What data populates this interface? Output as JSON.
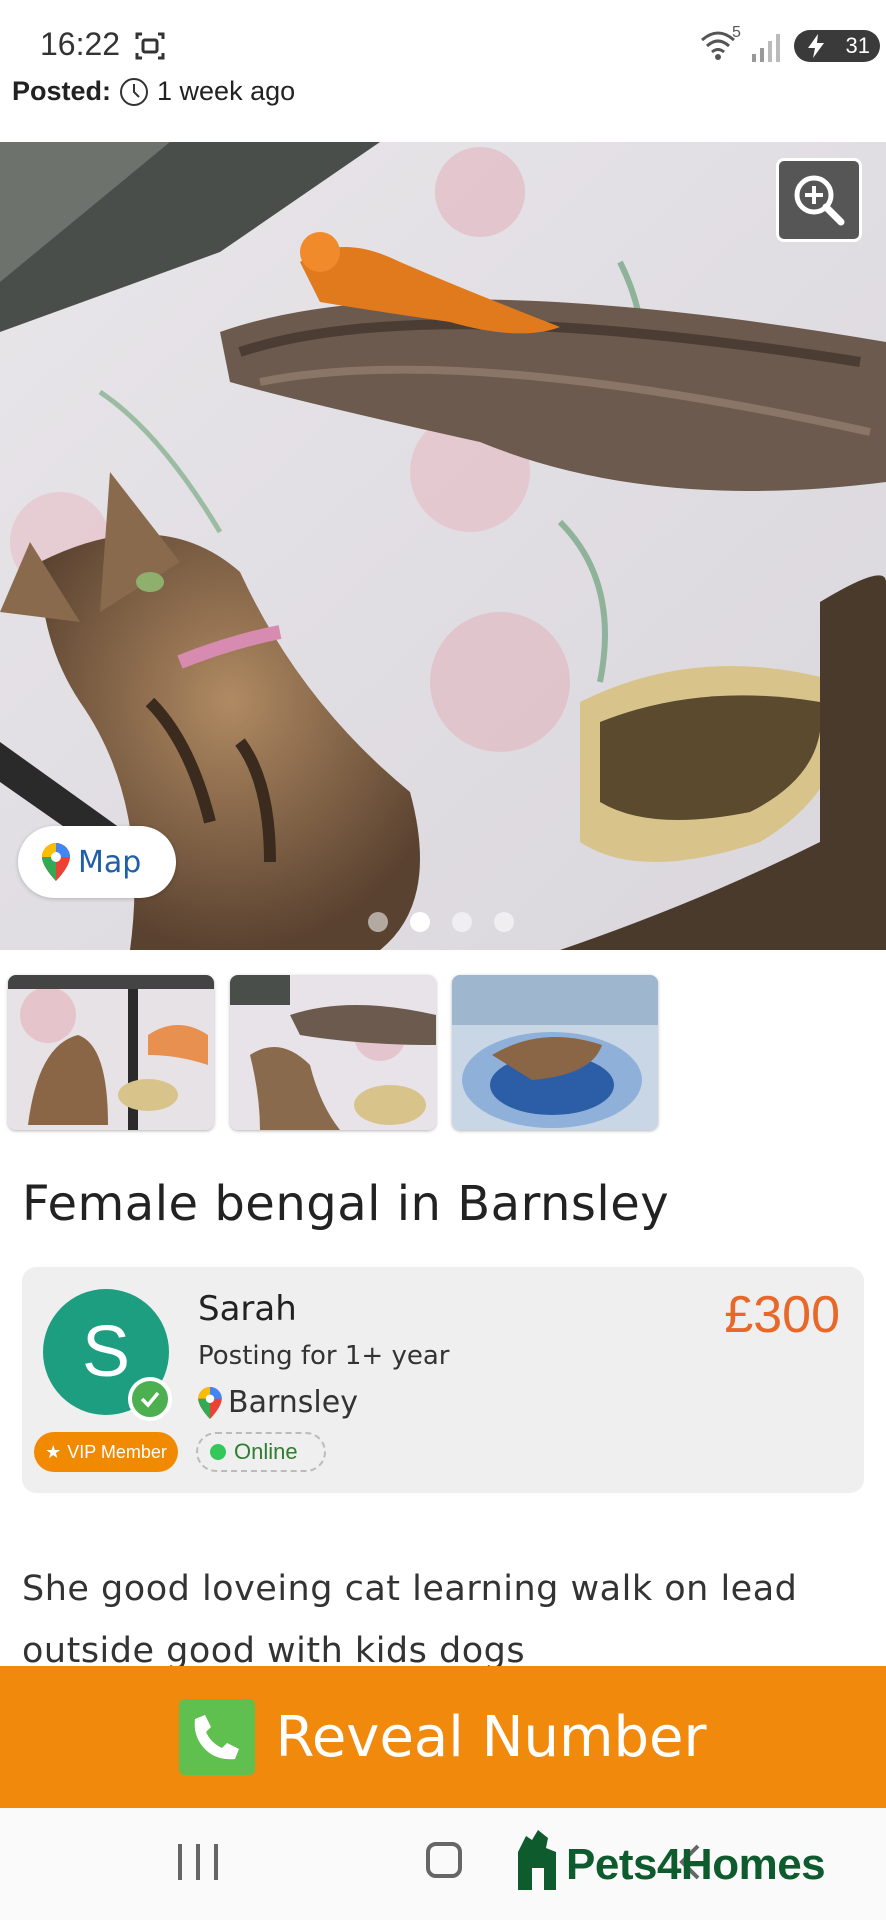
{
  "status_bar": {
    "time": "16:22",
    "battery": "31",
    "wifi_badge": "5"
  },
  "listing": {
    "posted_label": "Posted:",
    "posted_value": "1 week ago",
    "title": "Female bengal in Barnsley",
    "map_label": "Map",
    "image_count": 4,
    "active_image_index": 1,
    "thumbnail_count": 3,
    "description": "She good loveing cat learning walk on lead outside good with kids dogs"
  },
  "seller": {
    "avatar_letter": "S",
    "name": "Sarah",
    "posting_for": "Posting for 1+ year",
    "location": "Barnsley",
    "vip_label": "VIP Member",
    "online_label": "Online",
    "price": "£300"
  },
  "cta": {
    "reveal_label": "Reveal Number"
  },
  "brand": {
    "name": "Pets4Homes"
  },
  "colors": {
    "accent_orange": "#f18a0c",
    "price_orange": "#e8682a",
    "avatar_green": "#1d9e80",
    "brand_green": "#0e5b2e",
    "phone_green": "#5fc04f"
  }
}
